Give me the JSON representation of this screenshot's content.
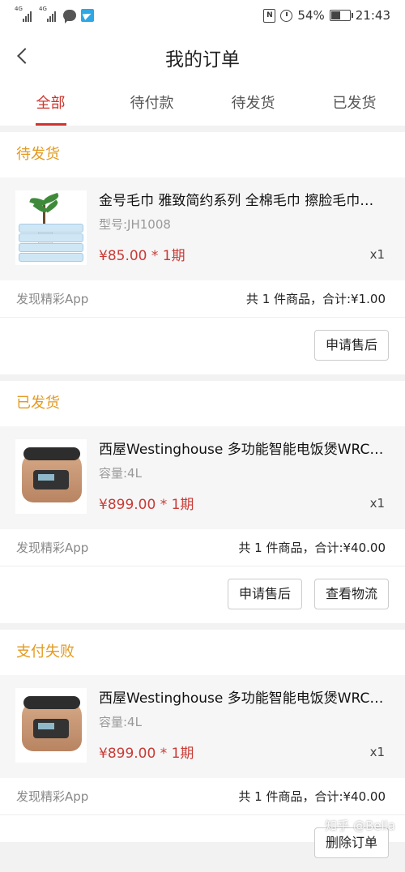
{
  "status_bar": {
    "net1": "4G",
    "net2": "4G",
    "battery_percent": "54%",
    "battery_level": 0.54,
    "time": "21:43"
  },
  "header": {
    "title": "我的订单"
  },
  "tabs": [
    {
      "label": "全部",
      "active": true
    },
    {
      "label": "待付款",
      "active": false
    },
    {
      "label": "待发货",
      "active": false
    },
    {
      "label": "已发货",
      "active": false
    }
  ],
  "orders": [
    {
      "status": "待发货",
      "item": {
        "title": "金号毛巾 雅致简约系列 全棉毛巾 擦脸毛巾…",
        "spec": "型号:JH1008",
        "price": "¥85.00 * 1期",
        "qty": "x1",
        "image": "towel-image"
      },
      "shop": "发现精彩App",
      "summary": "共 1 件商品，合计:¥1.00",
      "actions": [
        "申请售后"
      ]
    },
    {
      "status": "已发货",
      "item": {
        "title": "西屋Westinghouse 多功能智能电饭煲WRC…",
        "spec": "容量:4L",
        "price": "¥899.00 * 1期",
        "qty": "x1",
        "image": "rice-cooker-image"
      },
      "shop": "发现精彩App",
      "summary": "共 1 件商品，合计:¥40.00",
      "actions": [
        "申请售后",
        "查看物流"
      ]
    },
    {
      "status": "支付失败",
      "item": {
        "title": "西屋Westinghouse 多功能智能电饭煲WRC…",
        "spec": "容量:4L",
        "price": "¥899.00 * 1期",
        "qty": "x1",
        "image": "rice-cooker-image"
      },
      "shop": "发现精彩App",
      "summary": "共 1 件商品，合计:¥40.00",
      "actions": [
        "删除订单"
      ]
    }
  ],
  "watermark": "知乎 @Bella",
  "colors": {
    "accent": "#d0342c",
    "status": "#e39a20",
    "price": "#c93b36"
  }
}
